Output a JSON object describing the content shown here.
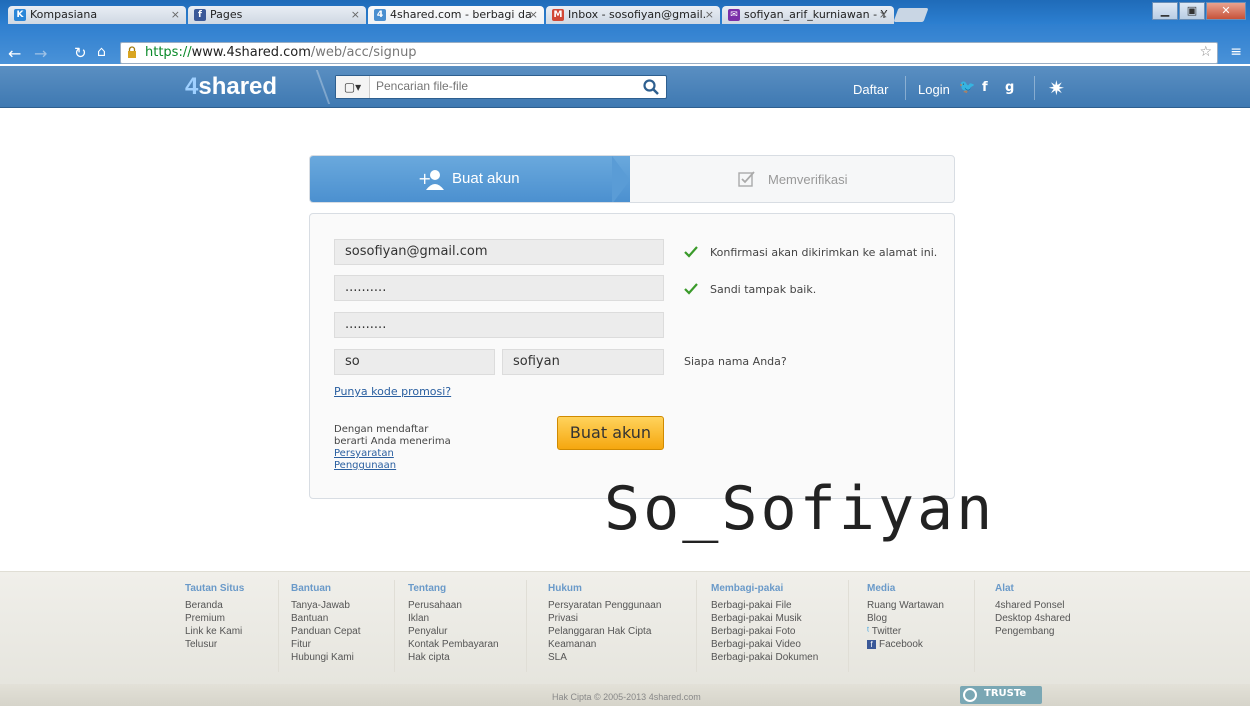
{
  "browser": {
    "tabs": [
      {
        "title": "Kompasiana",
        "icon_color": "#2a86d8",
        "icon_glyph": "K"
      },
      {
        "title": "Pages",
        "icon_color": "#3b5998",
        "icon_glyph": "f"
      },
      {
        "title": "4shared.com - berbagi da",
        "icon_color": "#4a8fd0",
        "icon_glyph": "4"
      },
      {
        "title": "Inbox - sosofiyan@gmail.",
        "icon_color": "#d14836",
        "icon_glyph": "M"
      },
      {
        "title": "sofiyan_arif_kurniawan - Y",
        "icon_color": "#7b2fa8",
        "icon_glyph": "✉"
      }
    ],
    "url": {
      "scheme": "https://",
      "host": "www.4shared.com",
      "path": "/web/acc/signup"
    }
  },
  "header": {
    "logo_num": "4",
    "logo_text": "shared",
    "search_placeholder": "Pencarian file-file",
    "file_type_glyph": "▢▾",
    "daftar": "Daftar",
    "login": "Login",
    "social": [
      "🐦",
      "f",
      "g"
    ]
  },
  "steps": {
    "create": "Buat akun",
    "verify": "Memverifikasi"
  },
  "form": {
    "email": "sosofiyan@gmail.com",
    "password": "..........",
    "password_confirm": "..........",
    "first_name": "so",
    "last_name": "sofiyan",
    "email_hint": "Konfirmasi akan dikirimkan ke alamat ini.",
    "password_hint": "Sandi tampak baik.",
    "name_hint": "Siapa nama Anda?",
    "promo": "Punya kode promosi?",
    "terms_line1": "Dengan mendaftar",
    "terms_line2": "berarti Anda menerima",
    "terms_link1": "Persyaratan",
    "terms_link2": "Penggunaan",
    "submit": "Buat akun"
  },
  "watermark": "So_Sofiyan",
  "footer": {
    "columns": [
      {
        "heading": "Tautan Situs",
        "items": [
          "Beranda",
          "Premium",
          "Link ke Kami",
          "Telusur"
        ]
      },
      {
        "heading": "Bantuan",
        "items": [
          "Tanya-Jawab",
          "Bantuan",
          "Panduan Cepat",
          "Fitur",
          "Hubungi Kami"
        ]
      },
      {
        "heading": "Tentang",
        "items": [
          "Perusahaan",
          "Iklan",
          "Penyalur",
          "Kontak Pembayaran",
          "Hak cipta"
        ]
      },
      {
        "heading": "Hukum",
        "items": [
          "Persyaratan Penggunaan",
          "Privasi",
          "Pelanggaran Hak Cipta",
          "Keamanan",
          "SLA"
        ]
      },
      {
        "heading": "Membagi-pakai",
        "items": [
          "Berbagi-pakai File",
          "Berbagi-pakai Musik",
          "Berbagi-pakai Foto",
          "Berbagi-pakai Video",
          "Berbagi-pakai Dokumen"
        ]
      },
      {
        "heading": "Media",
        "items": [
          "Ruang Wartawan",
          "Blog",
          "Twitter",
          "Facebook"
        ]
      },
      {
        "heading": "Alat",
        "items": [
          "4shared Ponsel",
          "Desktop 4shared",
          "Pengembang"
        ]
      }
    ],
    "copyright": "Hak Cipta © 2005-2013 4shared.com",
    "truste": "TRUSTe"
  },
  "colors": {
    "accent": "#4a8fcf",
    "cta": "#f5a70f",
    "check": "#3a9a2a"
  }
}
